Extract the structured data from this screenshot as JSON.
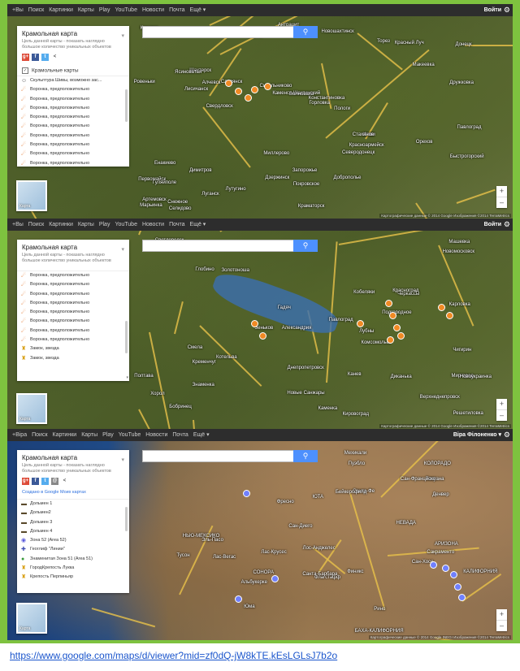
{
  "gbar": {
    "items_ru": [
      "+Вы",
      "Поиск",
      "Картинки",
      "Карты",
      "Play",
      "YouTube",
      "Новости",
      "Почта",
      "Ещё ▾"
    ],
    "items_ua": [
      "+Віра",
      "Поиск",
      "Картинки",
      "Карты",
      "Play",
      "YouTube",
      "Новости",
      "Почта",
      "Ещё ▾"
    ],
    "login": "Войти",
    "user": "Віра Філоненко ▾"
  },
  "panel": {
    "title": "Крамольная карта",
    "description": "Цель данной карты - показать наглядно большое количество уникальных объектов",
    "created_by": "Создано в Google Моих картах",
    "layer_name": "Крамольные карты"
  },
  "shot1": {
    "items": [
      {
        "icon": "person-icon",
        "label": "Скульптура Шивы, возможно зас..."
      },
      {
        "icon": "crater-icon",
        "label": "Воронка, предположительно"
      },
      {
        "icon": "crater-icon",
        "label": "Воронка, предположительно"
      },
      {
        "icon": "crater-icon",
        "label": "Воронка, предположительно"
      },
      {
        "icon": "crater-icon",
        "label": "Воронка, предположительно"
      },
      {
        "icon": "crater-icon",
        "label": "Воронка, предположительно"
      },
      {
        "icon": "crater-icon",
        "label": "Воронка, предположительно"
      },
      {
        "icon": "crater-icon",
        "label": "Воронка, предположительно"
      },
      {
        "icon": "crater-icon",
        "label": "Воронка, предположительно"
      },
      {
        "icon": "crater-icon",
        "label": "Воронка, предположительно"
      }
    ],
    "cities": [
      "Изюм",
      "Краматорск",
      "Славянск",
      "Лисичанск",
      "Северодонецк",
      "Луганск",
      "Дружковка",
      "Константиновка",
      "Артемовск",
      "Дзержинск",
      "Горловка",
      "Енакиево",
      "Макеевка",
      "Донецк",
      "Красноармейск",
      "Доброполье",
      "Димитров",
      "Селидово",
      "Марьинка",
      "Запорожье",
      "Красный Луч",
      "Антрацит",
      "Свердловск",
      "Ровеньки",
      "Шахтерск",
      "Торез",
      "Снежное",
      "Новошахтинск",
      "Шахты",
      "Каменск-Шахтинский",
      "Быстрогорский",
      "Миллерово",
      "Лутугино",
      "Стаханов",
      "Алчевск",
      "Первомайск",
      "Кировск",
      "Ясиноватая",
      "Павлоград",
      "Синельниково",
      "Покровское",
      "Волноваха",
      "Гуляйполе",
      "Пологи",
      "Орехов"
    ],
    "copyright": "Картографические данные © 2014 Google Изображения ©2014 TerraMetrics"
  },
  "shot2": {
    "items": [
      {
        "icon": "crater-icon",
        "label": "Воронка, предположительно"
      },
      {
        "icon": "crater-icon",
        "label": "Воронка, предположительно"
      },
      {
        "icon": "crater-icon",
        "label": "Воронка, предположительно"
      },
      {
        "icon": "crater-icon",
        "label": "Воронка, предположительно"
      },
      {
        "icon": "crater-icon",
        "label": "Воронка, предположительно"
      },
      {
        "icon": "crater-icon",
        "label": "Воронка, предположительно"
      },
      {
        "icon": "crater-icon",
        "label": "Воронка, предположительно"
      },
      {
        "icon": "crater-icon",
        "label": "Воронка, предположительно"
      },
      {
        "icon": "castle-icon",
        "label": "Замок, звезда"
      },
      {
        "icon": "castle-icon",
        "label": "Замок, звезда"
      }
    ],
    "cities": [
      "Черкассы",
      "Смела",
      "Полтава",
      "Кременчуг",
      "Светловодск",
      "Комсомольск",
      "Александрия",
      "Кировоград",
      "Днепропетровск",
      "Новомосковск",
      "Знаменка",
      "Лубны",
      "Миргород",
      "Хорол",
      "Кобеляки",
      "Верхнеднепровск",
      "Павлоград",
      "Подгородное",
      "Новоукраинка",
      "Бобринец",
      "Золотоноша",
      "Канев",
      "Чигирин",
      "Каменка",
      "Глобино",
      "Новые Санжары",
      "Машевка",
      "Карловка",
      "Решетиловка",
      "Диканька",
      "Котельва",
      "Красноград",
      "Зеньков",
      "Гадяч"
    ],
    "copyright": "Картографические данные © 2014 Google Изображения ©2014 TerraMetrics"
  },
  "shot3": {
    "items": [
      {
        "icon": "dolmen-icon",
        "label": "Дольмен 1"
      },
      {
        "icon": "dolmen-icon",
        "label": "Дольмен2"
      },
      {
        "icon": "dolmen-icon",
        "label": "Дольмен 3"
      },
      {
        "icon": "dolmen-icon",
        "label": "Дольмен 4"
      },
      {
        "icon": "zone-icon",
        "label": "Зона 52 (Area 52)"
      },
      {
        "icon": "geoglyph-icon",
        "label": "Геоглиф \"Линии\""
      },
      {
        "icon": "globe-icon",
        "label": "Знаменитая Зона 51 (Area 51)"
      },
      {
        "icon": "castle-icon",
        "label": "ГородКрепость Лукка"
      },
      {
        "icon": "castle-icon",
        "label": "Крепость Перпиньяр"
      }
    ],
    "cities": [
      "КОЛОРАДО",
      "ЮТА",
      "НЕВАДА",
      "КАЛИФОРНИЯ",
      "АРИЗОНА",
      "НЬЮ-МЕКСИКО",
      "Лас-Вегас",
      "Лос-Анджелес",
      "Сан-Диего",
      "Тихуана",
      "Финикс",
      "Тусон",
      "Альбукерке",
      "Санта-Фе",
      "Фресно",
      "Сан-Хосе",
      "Сакраменто",
      "Рино",
      "Сан-Франциско",
      "БАХА-КАЛИФОРНИЯ",
      "СОНОРА",
      "Флагстафф",
      "Юма",
      "Мехикали",
      "Лас-Крусес",
      "Эль-Пасо",
      "Денвер",
      "Пуэбло",
      "Бейкерсфилд",
      "Санта-Барбара"
    ],
    "copyright": "Картографические данные © 2014 Google INEGI Изображения ©2014 TerraMetrics"
  },
  "thumb_label": "Карта",
  "url": "https://www.google.com/maps/d/viewer?mid=zf0dQ-jW8kTE.kEsLGLsJ7b2o"
}
